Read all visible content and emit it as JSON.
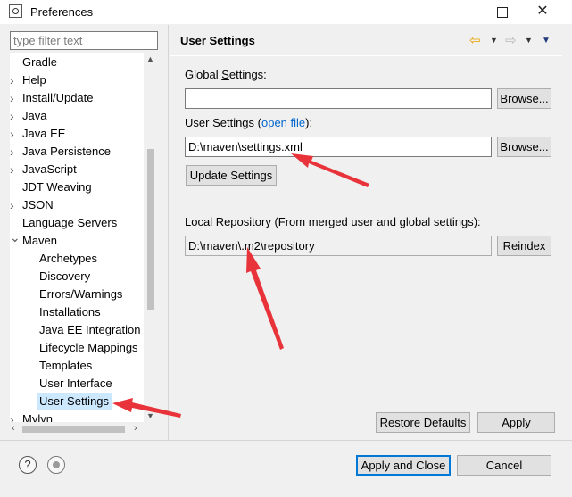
{
  "window": {
    "title": "Preferences",
    "minimize_icon": "minimize-icon",
    "maximize_icon": "maximize-icon",
    "close_icon": "close-icon"
  },
  "filter": {
    "placeholder": "type filter text",
    "value": ""
  },
  "tree": {
    "items": [
      {
        "label": "Gradle",
        "level": 0,
        "expandable": false
      },
      {
        "label": "Help",
        "level": 0,
        "expandable": true,
        "expanded": false
      },
      {
        "label": "Install/Update",
        "level": 0,
        "expandable": true,
        "expanded": false
      },
      {
        "label": "Java",
        "level": 0,
        "expandable": true,
        "expanded": false
      },
      {
        "label": "Java EE",
        "level": 0,
        "expandable": true,
        "expanded": false
      },
      {
        "label": "Java Persistence",
        "level": 0,
        "expandable": true,
        "expanded": false
      },
      {
        "label": "JavaScript",
        "level": 0,
        "expandable": true,
        "expanded": false
      },
      {
        "label": "JDT Weaving",
        "level": 0,
        "expandable": false
      },
      {
        "label": "JSON",
        "level": 0,
        "expandable": true,
        "expanded": false
      },
      {
        "label": "Language Servers",
        "level": 0,
        "expandable": false
      },
      {
        "label": "Maven",
        "level": 0,
        "expandable": true,
        "expanded": true
      },
      {
        "label": "Archetypes",
        "level": 1
      },
      {
        "label": "Discovery",
        "level": 1
      },
      {
        "label": "Errors/Warnings",
        "level": 1
      },
      {
        "label": "Installations",
        "level": 1
      },
      {
        "label": "Java EE Integration",
        "level": 1
      },
      {
        "label": "Lifecycle Mappings",
        "level": 1
      },
      {
        "label": "Templates",
        "level": 1
      },
      {
        "label": "User Interface",
        "level": 1
      },
      {
        "label": "User Settings",
        "level": 1,
        "selected": true
      },
      {
        "label": "Mylyn",
        "level": 0,
        "expandable": true,
        "expanded": false
      }
    ]
  },
  "page": {
    "title": "User Settings",
    "global_label_prefix": "Global ",
    "global_label_mnemonic": "S",
    "global_label_suffix": "ettings:",
    "global_value": "",
    "browse_label": "Browse...",
    "user_label_prefix": "User ",
    "user_label_mnemonic": "S",
    "user_label_middle": "ettings (",
    "user_label_link": "open file",
    "user_label_suffix": "):",
    "user_value": "D:\\maven\\settings.xml",
    "update_label": "Update Settings",
    "local_repo_label": "Local Repository (From merged user and global settings):",
    "local_repo_value": "D:\\maven\\.m2\\repository",
    "reindex_label": "Reindex",
    "restore_defaults_label": "Restore Defaults",
    "apply_label": "Apply"
  },
  "footer": {
    "apply_close_label": "Apply and Close",
    "cancel_label": "Cancel"
  },
  "colors": {
    "accent": "#0078d7",
    "selection": "#cce8ff",
    "annotation_arrow": "#e8333a",
    "link": "#0066cc"
  }
}
